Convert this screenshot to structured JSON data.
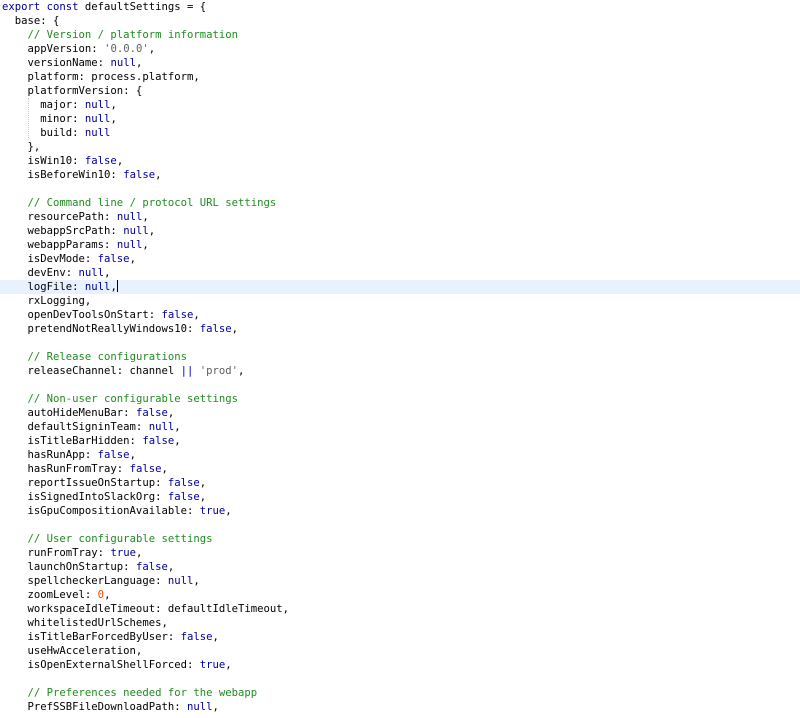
{
  "editor": {
    "active_line": 20,
    "lines": [
      [
        {
          "t": "kw",
          "v": "export const "
        },
        {
          "t": "plain",
          "v": "defaultSettings = {"
        }
      ],
      [
        {
          "t": "plain",
          "v": "  base: {"
        }
      ],
      [
        {
          "t": "plain",
          "v": "    "
        },
        {
          "t": "cm",
          "v": "// Version / platform information"
        }
      ],
      [
        {
          "t": "plain",
          "v": "    appVersion: "
        },
        {
          "t": "str",
          "v": "'0.0.0'"
        },
        {
          "t": "plain",
          "v": ","
        }
      ],
      [
        {
          "t": "plain",
          "v": "    versionName: "
        },
        {
          "t": "lit",
          "v": "null"
        },
        {
          "t": "plain",
          "v": ","
        }
      ],
      [
        {
          "t": "plain",
          "v": "    platform: process.platform,"
        }
      ],
      [
        {
          "t": "plain",
          "v": "    platformVersion: {"
        }
      ],
      [
        {
          "t": "plain",
          "v": "      major: "
        },
        {
          "t": "lit",
          "v": "null"
        },
        {
          "t": "plain",
          "v": ","
        }
      ],
      [
        {
          "t": "plain",
          "v": "      minor: "
        },
        {
          "t": "lit",
          "v": "null"
        },
        {
          "t": "plain",
          "v": ","
        }
      ],
      [
        {
          "t": "plain",
          "v": "      build: "
        },
        {
          "t": "lit",
          "v": "null"
        }
      ],
      [
        {
          "t": "plain",
          "v": "    },"
        }
      ],
      [
        {
          "t": "plain",
          "v": "    isWin10: "
        },
        {
          "t": "lit",
          "v": "false"
        },
        {
          "t": "plain",
          "v": ","
        }
      ],
      [
        {
          "t": "plain",
          "v": "    isBeforeWin10: "
        },
        {
          "t": "lit",
          "v": "false"
        },
        {
          "t": "plain",
          "v": ","
        }
      ],
      [],
      [
        {
          "t": "plain",
          "v": "    "
        },
        {
          "t": "cm",
          "v": "// Command line / protocol URL settings"
        }
      ],
      [
        {
          "t": "plain",
          "v": "    resourcePath: "
        },
        {
          "t": "lit",
          "v": "null"
        },
        {
          "t": "plain",
          "v": ","
        }
      ],
      [
        {
          "t": "plain",
          "v": "    webappSrcPath: "
        },
        {
          "t": "lit",
          "v": "null"
        },
        {
          "t": "plain",
          "v": ","
        }
      ],
      [
        {
          "t": "plain",
          "v": "    webappParams: "
        },
        {
          "t": "lit",
          "v": "null"
        },
        {
          "t": "plain",
          "v": ","
        }
      ],
      [
        {
          "t": "plain",
          "v": "    isDevMode: "
        },
        {
          "t": "lit",
          "v": "false"
        },
        {
          "t": "plain",
          "v": ","
        }
      ],
      [
        {
          "t": "plain",
          "v": "    devEnv: "
        },
        {
          "t": "lit",
          "v": "null"
        },
        {
          "t": "plain",
          "v": ","
        }
      ],
      [
        {
          "t": "plain",
          "v": "    logFile: "
        },
        {
          "t": "lit",
          "v": "null"
        },
        {
          "t": "plain",
          "v": ","
        }
      ],
      [
        {
          "t": "plain",
          "v": "    rxLogging,"
        }
      ],
      [
        {
          "t": "plain",
          "v": "    openDevToolsOnStart: "
        },
        {
          "t": "lit",
          "v": "false"
        },
        {
          "t": "plain",
          "v": ","
        }
      ],
      [
        {
          "t": "plain",
          "v": "    pretendNotReallyWindows10: "
        },
        {
          "t": "lit",
          "v": "false"
        },
        {
          "t": "plain",
          "v": ","
        }
      ],
      [],
      [
        {
          "t": "plain",
          "v": "    "
        },
        {
          "t": "cm",
          "v": "// Release configurations"
        }
      ],
      [
        {
          "t": "plain",
          "v": "    releaseChannel: channel "
        },
        {
          "t": "kw",
          "v": "||"
        },
        {
          "t": "plain",
          "v": " "
        },
        {
          "t": "str",
          "v": "'prod'"
        },
        {
          "t": "plain",
          "v": ","
        }
      ],
      [],
      [
        {
          "t": "plain",
          "v": "    "
        },
        {
          "t": "cm",
          "v": "// Non-user configurable settings"
        }
      ],
      [
        {
          "t": "plain",
          "v": "    autoHideMenuBar: "
        },
        {
          "t": "lit",
          "v": "false"
        },
        {
          "t": "plain",
          "v": ","
        }
      ],
      [
        {
          "t": "plain",
          "v": "    defaultSigninTeam: "
        },
        {
          "t": "lit",
          "v": "null"
        },
        {
          "t": "plain",
          "v": ","
        }
      ],
      [
        {
          "t": "plain",
          "v": "    isTitleBarHidden: "
        },
        {
          "t": "lit",
          "v": "false"
        },
        {
          "t": "plain",
          "v": ","
        }
      ],
      [
        {
          "t": "plain",
          "v": "    hasRunApp: "
        },
        {
          "t": "lit",
          "v": "false"
        },
        {
          "t": "plain",
          "v": ","
        }
      ],
      [
        {
          "t": "plain",
          "v": "    hasRunFromTray: "
        },
        {
          "t": "lit",
          "v": "false"
        },
        {
          "t": "plain",
          "v": ","
        }
      ],
      [
        {
          "t": "plain",
          "v": "    reportIssueOnStartup: "
        },
        {
          "t": "lit",
          "v": "false"
        },
        {
          "t": "plain",
          "v": ","
        }
      ],
      [
        {
          "t": "plain",
          "v": "    isSignedIntoSlackOrg: "
        },
        {
          "t": "lit",
          "v": "false"
        },
        {
          "t": "plain",
          "v": ","
        }
      ],
      [
        {
          "t": "plain",
          "v": "    isGpuCompositionAvailable: "
        },
        {
          "t": "lit",
          "v": "true"
        },
        {
          "t": "plain",
          "v": ","
        }
      ],
      [],
      [
        {
          "t": "plain",
          "v": "    "
        },
        {
          "t": "cm",
          "v": "// User configurable settings"
        }
      ],
      [
        {
          "t": "plain",
          "v": "    runFromTray: "
        },
        {
          "t": "lit",
          "v": "true"
        },
        {
          "t": "plain",
          "v": ","
        }
      ],
      [
        {
          "t": "plain",
          "v": "    launchOnStartup: "
        },
        {
          "t": "lit",
          "v": "false"
        },
        {
          "t": "plain",
          "v": ","
        }
      ],
      [
        {
          "t": "plain",
          "v": "    spellcheckerLanguage: "
        },
        {
          "t": "lit",
          "v": "null"
        },
        {
          "t": "plain",
          "v": ","
        }
      ],
      [
        {
          "t": "plain",
          "v": "    zoomLevel: "
        },
        {
          "t": "num",
          "v": "0"
        },
        {
          "t": "plain",
          "v": ","
        }
      ],
      [
        {
          "t": "plain",
          "v": "    workspaceIdleTimeout: defaultIdleTimeout,"
        }
      ],
      [
        {
          "t": "plain",
          "v": "    whitelistedUrlSchemes,"
        }
      ],
      [
        {
          "t": "plain",
          "v": "    isTitleBarForcedByUser: "
        },
        {
          "t": "lit",
          "v": "false"
        },
        {
          "t": "plain",
          "v": ","
        }
      ],
      [
        {
          "t": "plain",
          "v": "    useHwAcceleration,"
        }
      ],
      [
        {
          "t": "plain",
          "v": "    isOpenExternalShellForced: "
        },
        {
          "t": "lit",
          "v": "true"
        },
        {
          "t": "plain",
          "v": ","
        }
      ],
      [],
      [
        {
          "t": "plain",
          "v": "    "
        },
        {
          "t": "cm",
          "v": "// Preferences needed for the webapp"
        }
      ],
      [
        {
          "t": "plain",
          "v": "    PrefSSBFileDownloadPath: "
        },
        {
          "t": "lit",
          "v": "null"
        },
        {
          "t": "plain",
          "v": ","
        }
      ]
    ]
  }
}
